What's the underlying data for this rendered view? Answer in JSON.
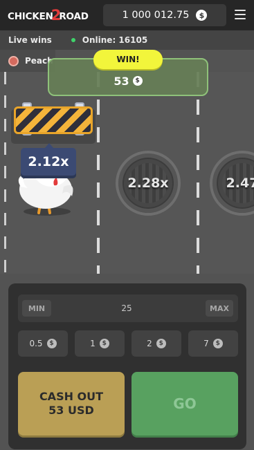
{
  "app": {
    "logo_left": "CHICKEN",
    "logo_mid": "2",
    "logo_right": "ROAD"
  },
  "header": {
    "balance": "1 000 012.75",
    "currency_icon": "$"
  },
  "live_bar": {
    "live_wins": "Live wins",
    "online": "Online: 16105"
  },
  "player": {
    "name": "Peach"
  },
  "road": {
    "chicken_multiplier": "2.12x",
    "manholes": [
      {
        "label": "2.28x"
      },
      {
        "label": "2.47"
      }
    ]
  },
  "win": {
    "badge": "WIN!",
    "amount": "53",
    "currency_icon": "$"
  },
  "controls": {
    "min_label": "MIN",
    "max_label": "MAX",
    "stake_value": "25",
    "chips": [
      {
        "label": "0.5"
      },
      {
        "label": "1"
      },
      {
        "label": "2"
      },
      {
        "label": "7"
      }
    ],
    "chip_currency_icon": "$",
    "cashout_line1": "CASH OUT",
    "cashout_line2": "53 USD",
    "go_label": "GO"
  },
  "colors": {
    "win_badge": "#f2f53b",
    "cashout": "#ba9f55",
    "go": "#58a160",
    "online_dot": "#3fd36b"
  }
}
